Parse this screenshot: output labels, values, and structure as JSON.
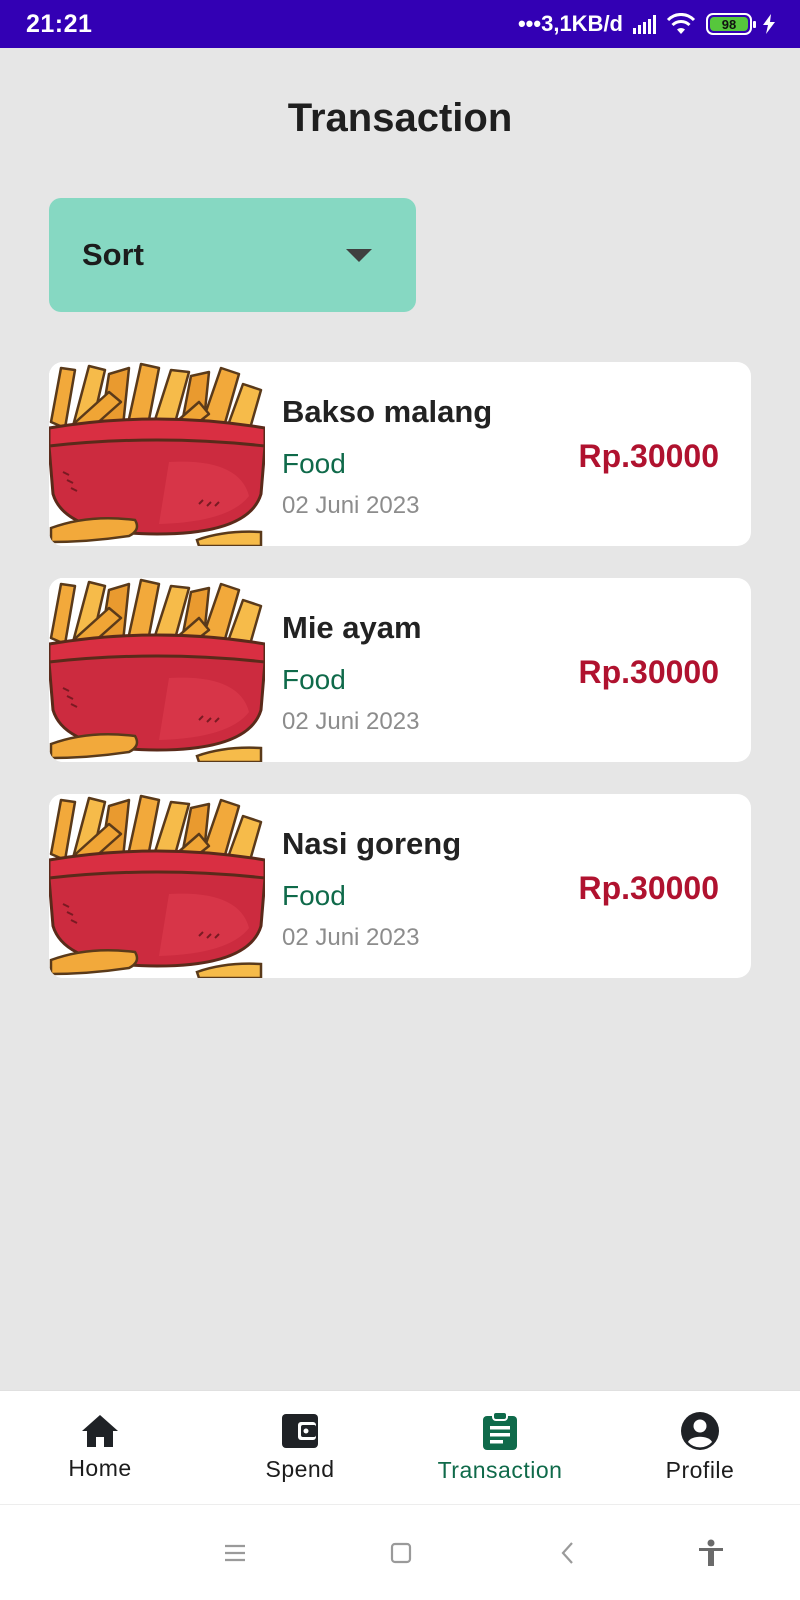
{
  "status_bar": {
    "time": "21:21",
    "network": "•••3,1KB/d",
    "battery": "98",
    "background_color": "#3300b4"
  },
  "page": {
    "title": "Transaction"
  },
  "sort": {
    "label": "Sort",
    "background_color": "#86d8c2"
  },
  "transactions": [
    {
      "name": "Bakso malang",
      "category": "Food",
      "date": "02 Juni 2023",
      "amount": "Rp.30000",
      "image_icon": "fries-bowl-icon"
    },
    {
      "name": "Mie ayam",
      "category": "Food",
      "date": "02 Juni 2023",
      "amount": "Rp.30000",
      "image_icon": "fries-bowl-icon"
    },
    {
      "name": "Nasi goreng",
      "category": "Food",
      "date": "02 Juni 2023",
      "amount": "Rp.30000",
      "image_icon": "fries-bowl-icon"
    }
  ],
  "colors": {
    "category": "#0f6a4a",
    "amount": "#b0122f",
    "active_nav": "#0f6a4a"
  },
  "bottom_nav": {
    "items": [
      {
        "label": "Home",
        "icon": "home-icon",
        "active": false
      },
      {
        "label": "Spend",
        "icon": "wallet-icon",
        "active": false
      },
      {
        "label": "Transaction",
        "icon": "clipboard-icon",
        "active": true
      },
      {
        "label": "Profile",
        "icon": "profile-icon",
        "active": false
      }
    ]
  },
  "system_nav": {
    "icons": [
      "menu-icon",
      "square-home-icon",
      "back-icon",
      "accessibility-icon"
    ]
  }
}
